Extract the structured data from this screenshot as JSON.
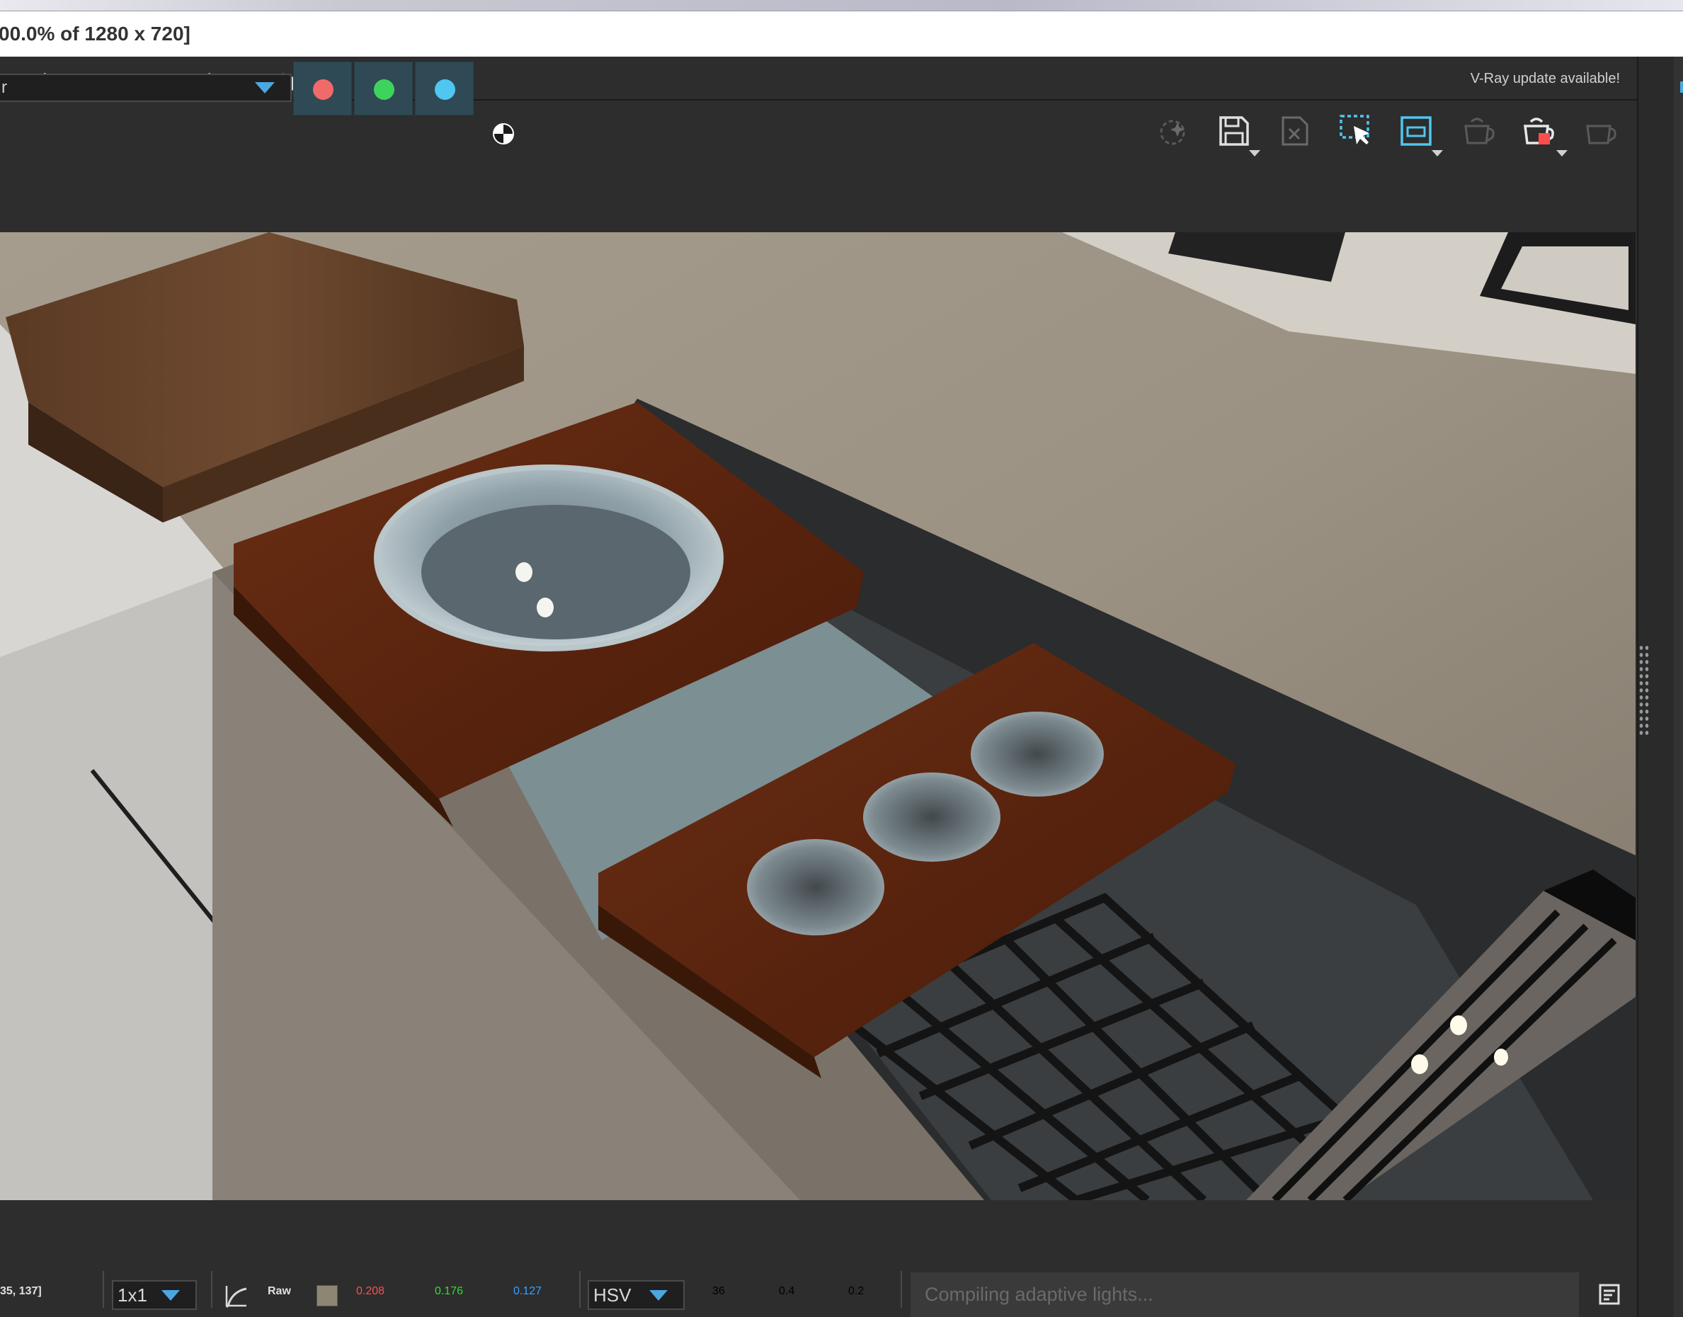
{
  "window": {
    "title": "00.0% of 1280 x 720]"
  },
  "menu": {
    "items": [
      "Render",
      "Image",
      "View",
      "Options"
    ],
    "update_notice": "V-Ray update available!"
  },
  "toolbar": {
    "channel_select_value": "r",
    "channels": [
      {
        "name": "red-channel",
        "color": "#f06a6a"
      },
      {
        "name": "green-channel",
        "color": "#3ed45c"
      },
      {
        "name": "blue-channel",
        "color": "#4fc7f0"
      }
    ],
    "icons": [
      "denoise-sparkle-icon",
      "save-image-icon",
      "clear-image-icon",
      "region-select-icon",
      "render-region-icon",
      "render-teapot-icon",
      "stop-render-teapot-icon",
      "interactive-teapot-icon"
    ]
  },
  "status": {
    "coords": "35, 137]",
    "sample_size": "1x1",
    "raw_label": "Raw",
    "swatch_color": "#8f8574",
    "r": "0.208",
    "g": "0.176",
    "b": "0.127",
    "color_mode": "HSV",
    "h": "36",
    "s": "0.4",
    "v": "0.2",
    "progress_text": "Compiling adaptive lights..."
  },
  "colors": {
    "accent": "#4aa8e0",
    "r_text": "#ff4d4d",
    "g_text": "#33dd33",
    "b_text": "#3aa0ff"
  }
}
